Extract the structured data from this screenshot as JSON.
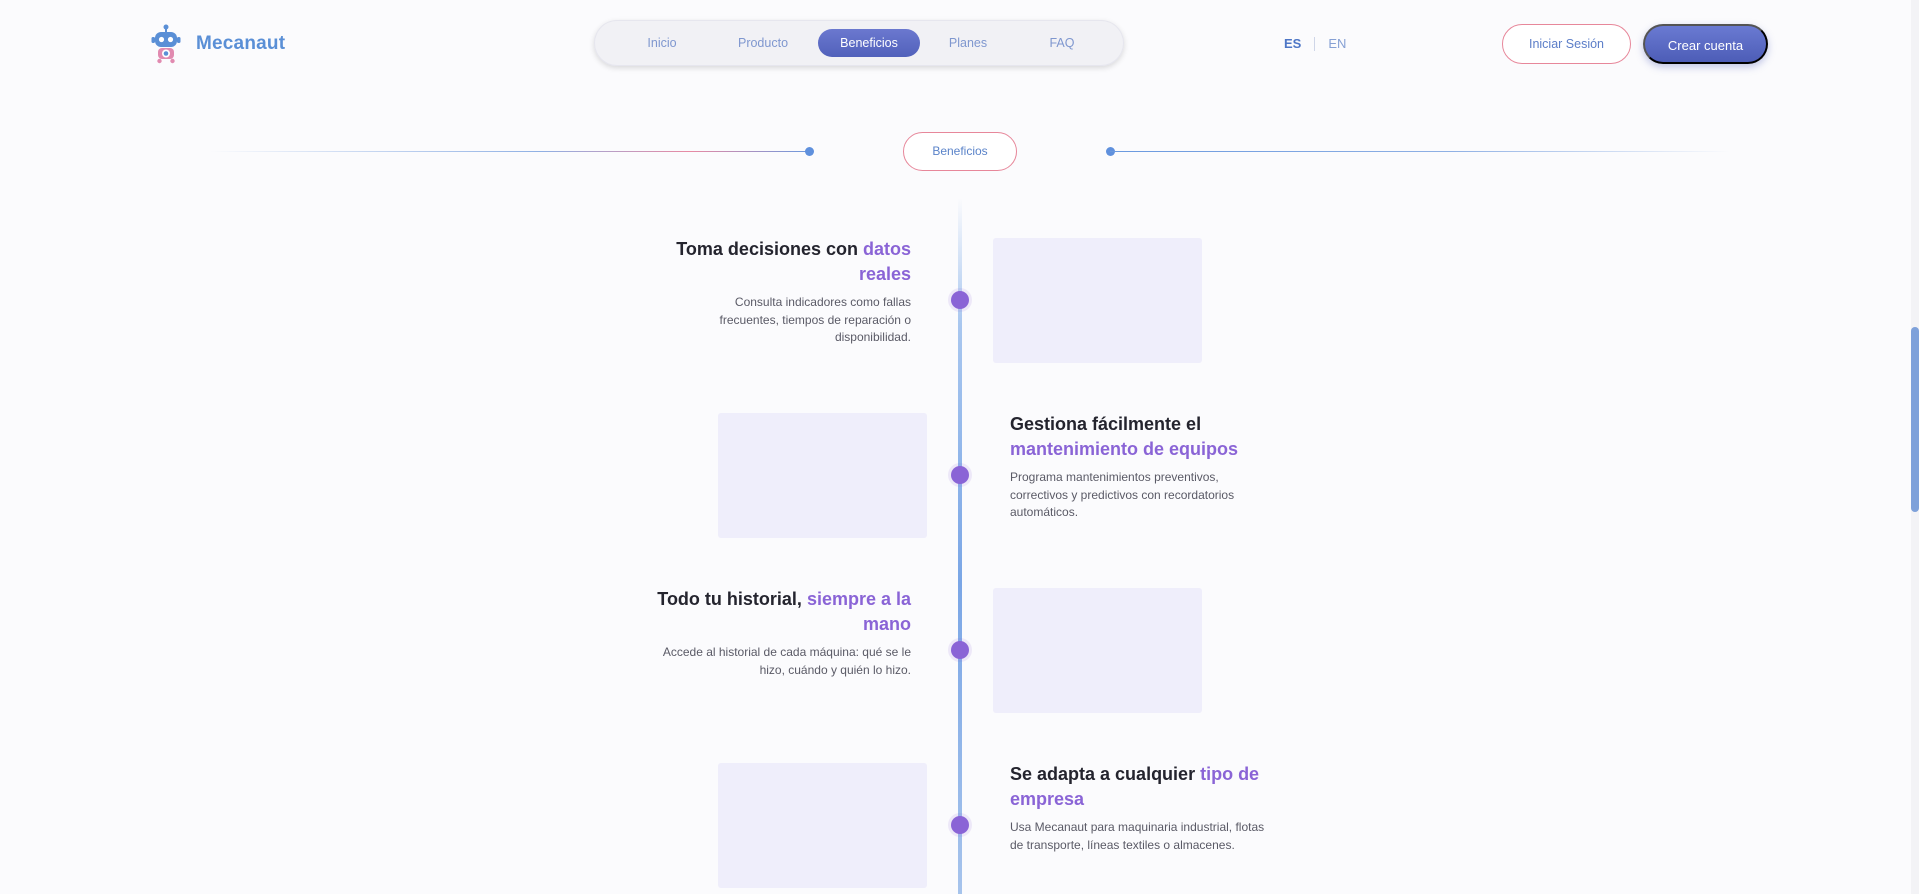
{
  "header": {
    "logo": {
      "text": "Mecanaut",
      "icon": "robot-icon"
    },
    "nav": [
      {
        "label": "Inicio",
        "active": false
      },
      {
        "label": "Producto",
        "active": false
      },
      {
        "label": "Beneficios",
        "active": true
      },
      {
        "label": "Planes",
        "active": false
      },
      {
        "label": "FAQ",
        "active": false
      }
    ],
    "lang": {
      "es": "ES",
      "en": "EN",
      "selected": "ES"
    },
    "login_label": "Iniciar Sesión",
    "signup_label": "Crear cuenta"
  },
  "section": {
    "pill": "Beneficios"
  },
  "features": [
    {
      "title_plain": "Toma decisiones con ",
      "title_accent": "datos reales",
      "desc": "Consulta indicadores como fallas frecuentes, tiempos de reparación o disponibilidad.",
      "side": "left"
    },
    {
      "title_plain": "Gestiona fácilmente el ",
      "title_accent": "mantenimiento de equipos",
      "desc": "Programa mantenimientos preventivos, correctivos y predictivos con recordatorios automáticos.",
      "side": "right"
    },
    {
      "title_plain": "Todo tu historial, ",
      "title_accent": "siempre a la mano",
      "desc": "Accede al historial de cada máquina: qué se le hizo, cuándo y quién lo hizo.",
      "side": "left"
    },
    {
      "title_plain": "Se adapta a cualquier ",
      "title_accent": "tipo de empresa",
      "desc": "Usa Mecanaut para maquinaria industrial, flotas de transporte, líneas textiles o almacenes.",
      "side": "right"
    }
  ],
  "colors": {
    "brand": "#5a8fd6",
    "accent": "#8a64d6",
    "button": "#5161bb",
    "pill_border": "#e7879a",
    "placeholder": "#efeefb"
  }
}
